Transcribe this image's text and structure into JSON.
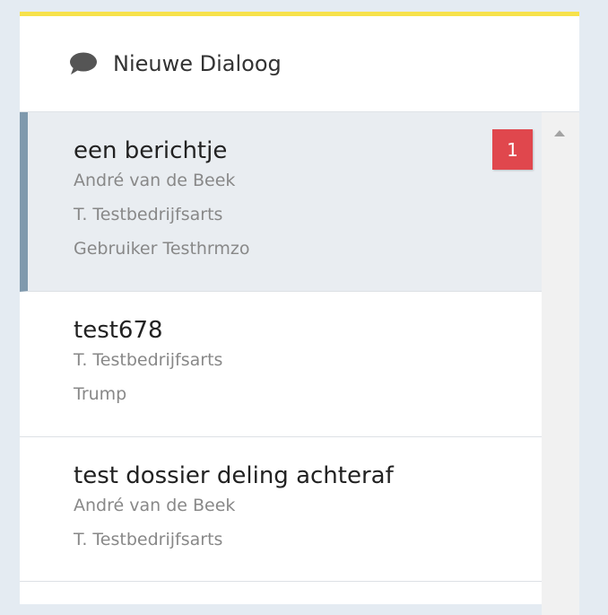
{
  "header": {
    "icon": "chat-bubble-icon",
    "label": "Nieuwe Dialoog"
  },
  "dialogs": [
    {
      "title": "een berichtje",
      "participants": [
        "André van de Beek",
        "T. Testbedrijfsarts",
        "Gebruiker Testhrmzo"
      ],
      "unread": "1",
      "active": true
    },
    {
      "title": "test678",
      "participants": [
        "T. Testbedrijfsarts",
        "Trump"
      ],
      "active": false
    },
    {
      "title": "test dossier deling achteraf",
      "participants": [
        "André van de Beek",
        "T. Testbedrijfsarts"
      ],
      "active": false
    }
  ],
  "colors": {
    "accent_top": "#f7e24b",
    "active_bar": "#7f99ad",
    "badge": "#e0474d"
  }
}
